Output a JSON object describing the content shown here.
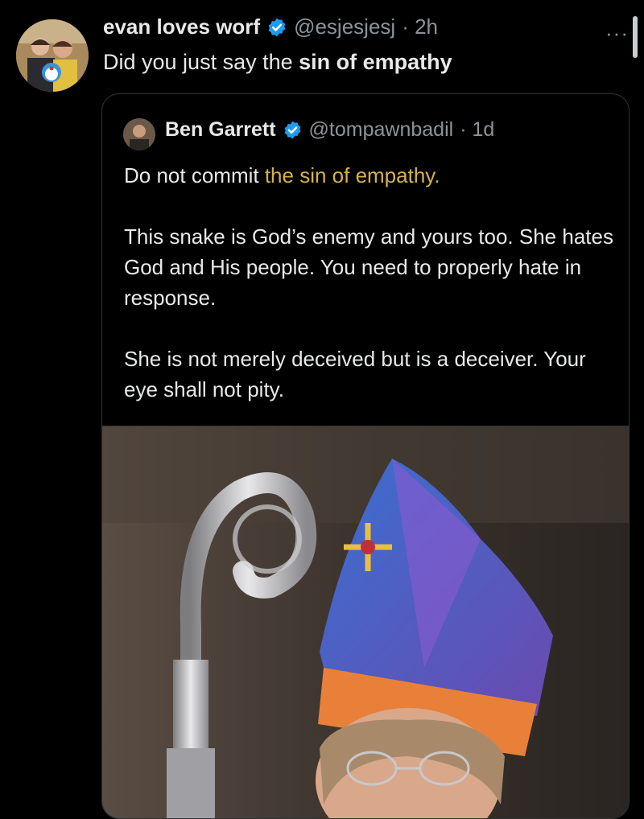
{
  "post": {
    "display_name": "evan loves worf",
    "handle": "@esjesjesj",
    "time": "· 2h",
    "text_prefix": "Did you just say the ",
    "text_bold": "sin of empathy",
    "more_label": "···"
  },
  "quote": {
    "display_name": "Ben Garrett",
    "handle": "@tompawnbadil",
    "time": "· 1d",
    "line1_prefix": "Do not commit ",
    "line1_highlight": "the sin of empathy.",
    "para2": "This snake is God’s enemy and yours too. She hates God and His people. You need to properly hate in response.",
    "para3": "She is not merely deceived but is a deceiver. Your eye shall not pity."
  },
  "icons": {
    "verified": "verified-badge-icon",
    "more": "more-options-icon"
  },
  "colors": {
    "background": "#000000",
    "text": "#e7e9ea",
    "muted": "#8b949b",
    "verified": "#1d9bf0",
    "highlight": "#d6b24a"
  }
}
